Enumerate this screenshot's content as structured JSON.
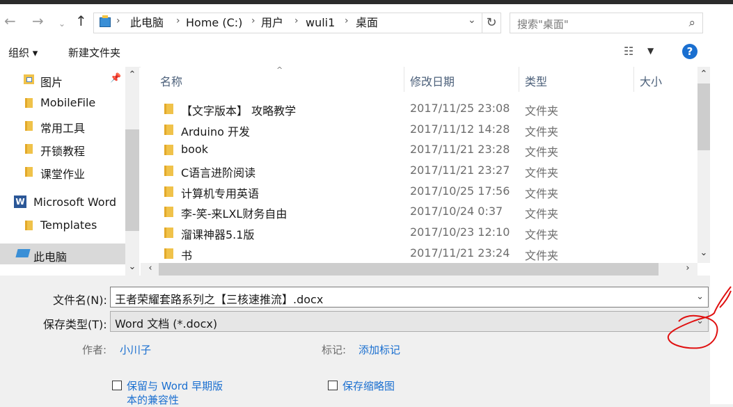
{
  "address": {
    "crumbs": [
      "此电脑",
      "Home (C:)",
      "用户",
      "wuli1",
      "桌面"
    ],
    "search_placeholder": "搜索\"桌面\""
  },
  "toolbar": {
    "organize": "组织 ▾",
    "new_folder": "新建文件夹",
    "help": "?"
  },
  "nav": {
    "items": [
      {
        "label": "图片",
        "icon": "pictures-folder-icon"
      },
      {
        "label": "MobileFile",
        "icon": "folder-icon"
      },
      {
        "label": "常用工具",
        "icon": "folder-icon"
      },
      {
        "label": "开锁教程",
        "icon": "folder-icon"
      },
      {
        "label": "课堂作业",
        "icon": "folder-icon"
      },
      {
        "label": "Microsoft Word",
        "icon": "word-icon"
      },
      {
        "label": "Templates",
        "icon": "folder-icon"
      },
      {
        "label": "此电脑",
        "icon": "computer-icon"
      }
    ]
  },
  "list": {
    "columns": [
      "名称",
      "修改日期",
      "类型",
      "大小"
    ],
    "rows": [
      {
        "name": "【文字版本】 攻略教学",
        "date": "2017/11/25 23:08",
        "type": "文件夹"
      },
      {
        "name": "Arduino 开发",
        "date": "2017/11/12 14:28",
        "type": "文件夹"
      },
      {
        "name": "book",
        "date": "2017/11/21 23:28",
        "type": "文件夹"
      },
      {
        "name": "C语言进阶阅读",
        "date": "2017/11/21 23:27",
        "type": "文件夹"
      },
      {
        "name": "计算机专用英语",
        "date": "2017/10/25 17:56",
        "type": "文件夹"
      },
      {
        "name": "李-笑-来LXL财务自由",
        "date": "2017/10/24 0:37",
        "type": "文件夹"
      },
      {
        "name": "溜课神器5.1版",
        "date": "2017/10/23 12:10",
        "type": "文件夹"
      },
      {
        "name": "书",
        "date": "2017/11/21 23:24",
        "type": "文件夹"
      }
    ]
  },
  "form": {
    "filename_label": "文件名(N):",
    "filename_value": "王者荣耀套路系列之【三核速推流】.docx",
    "filetype_label": "保存类型(T):",
    "filetype_value": "Word 文档 (*.docx)",
    "author_label": "作者:",
    "author_value": "小川子",
    "tags_label": "标记:",
    "tags_value": "添加标记",
    "compat_label_1": "保留与 Word 早期版",
    "compat_label_2": "本的兼容性",
    "thumbnail_label": "保存缩略图"
  },
  "colors": {
    "accent": "#1a6fd0",
    "folder": "#f0c24a",
    "annotation": "#e01010"
  }
}
